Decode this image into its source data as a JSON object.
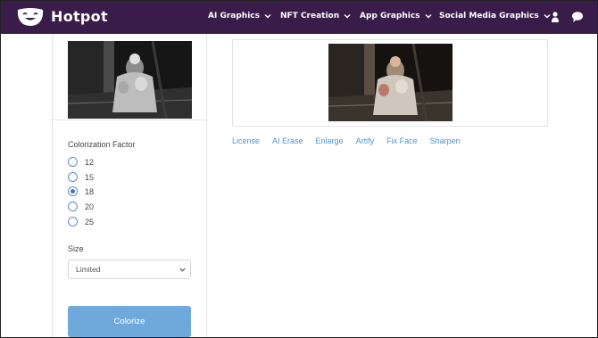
{
  "brand": {
    "name": "Hotpot",
    "logo_icon": "smiley-logo-icon"
  },
  "nav": {
    "items": [
      {
        "label": "AI Graphics"
      },
      {
        "label": "NFT Creation"
      },
      {
        "label": "App Graphics"
      },
      {
        "label": "Social Media Graphics"
      }
    ],
    "icons": [
      "user-icon",
      "chat-icon"
    ]
  },
  "form": {
    "colorization_label": "Colorization Factor",
    "options": [
      "12",
      "15",
      "18",
      "20",
      "25"
    ],
    "selected": "18",
    "size_label": "Size",
    "size_value": "Limited",
    "submit_label": "Colorize"
  },
  "result_links": [
    "License",
    "AI Erase",
    "Enlarge",
    "Artify",
    "Fix Face",
    "Sharpen"
  ],
  "colors": {
    "nav_bg": "#3a1c4a",
    "accent": "#6fa9dc",
    "link": "#4a97cf"
  }
}
